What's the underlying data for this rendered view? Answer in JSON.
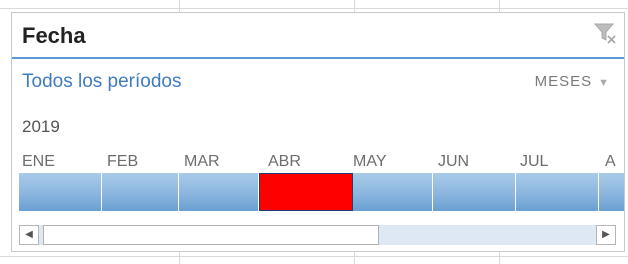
{
  "slicer": {
    "title": "Fecha",
    "clear_filter_icon": "funnel-clear-icon",
    "periods_label": "Todos los períodos",
    "level": "MESES",
    "level_caret_icon": "caret-down-icon",
    "year": "2019",
    "months": [
      {
        "label": "ENE",
        "selected": false
      },
      {
        "label": "FEB",
        "selected": false
      },
      {
        "label": "MAR",
        "selected": false
      },
      {
        "label": "ABR",
        "selected": true
      },
      {
        "label": "MAY",
        "selected": false
      },
      {
        "label": "JUN",
        "selected": false
      },
      {
        "label": "JUL",
        "selected": false
      },
      {
        "label": "A",
        "selected": false
      }
    ],
    "scroll_left_icon": "triangle-left-icon",
    "scroll_right_icon": "triangle-right-icon",
    "colors": {
      "accent": "#5b9bd5",
      "link": "#3f7cbf",
      "selected_tile": "#ff0000",
      "tile": "#8eb8e0"
    }
  }
}
